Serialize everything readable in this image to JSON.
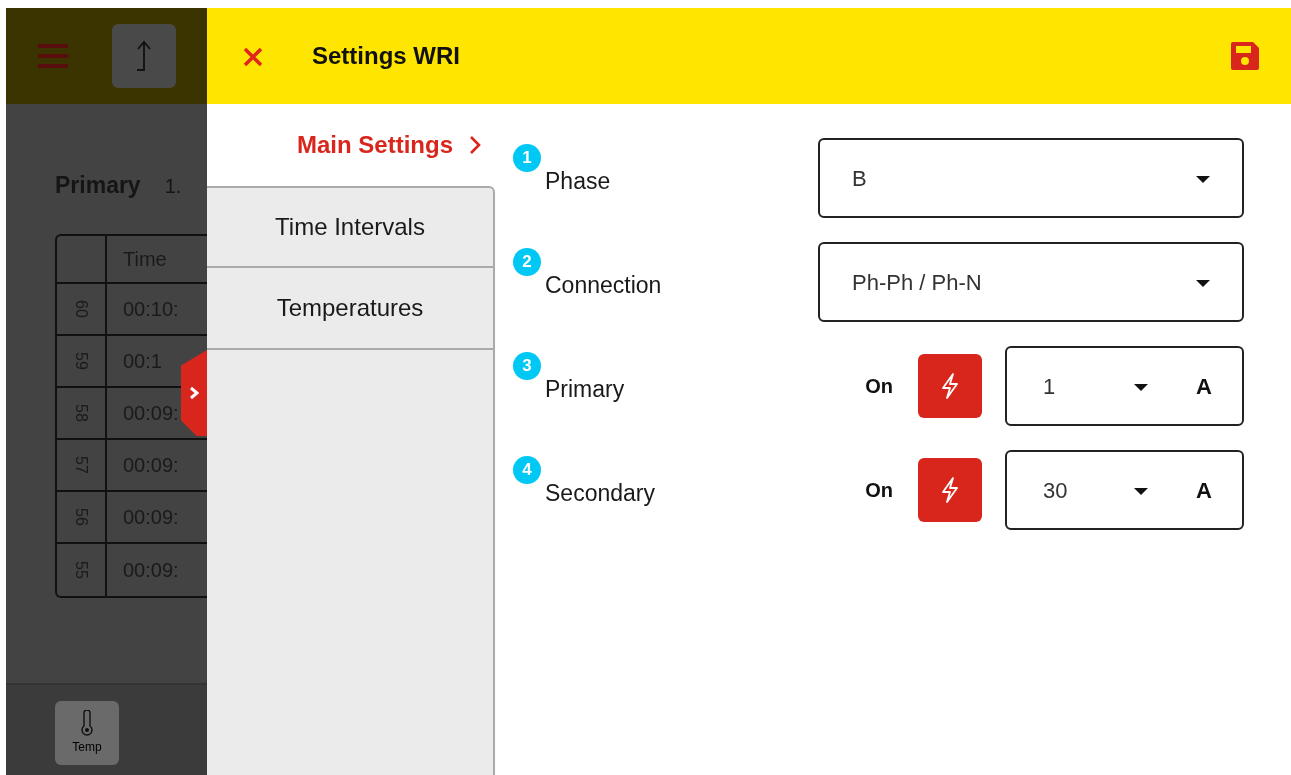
{
  "background_app": {
    "label": "Primary",
    "value": "1.",
    "table": {
      "columns": [
        "",
        "Time"
      ],
      "rows": [
        {
          "index": "60",
          "time": "00:10:"
        },
        {
          "index": "59",
          "time": "00:1"
        },
        {
          "index": "58",
          "time": "00:09:"
        },
        {
          "index": "57",
          "time": "00:09:"
        },
        {
          "index": "56",
          "time": "00:09:"
        },
        {
          "index": "55",
          "time": "00:09:"
        }
      ]
    },
    "bottom_bar": {
      "buttons": [
        {
          "label": "Temp"
        }
      ]
    }
  },
  "dialog": {
    "title": "Settings WRI",
    "menu": [
      {
        "label": "Main Settings",
        "selected": true
      },
      {
        "label": "Time Intervals",
        "selected": false
      },
      {
        "label": "Temperatures",
        "selected": false
      }
    ],
    "fields": [
      {
        "kind": "select",
        "number": "1",
        "label": "Phase",
        "value": "B"
      },
      {
        "kind": "select",
        "number": "2",
        "label": "Connection",
        "value": "Ph-Ph / Ph-N"
      },
      {
        "kind": "current",
        "number": "3",
        "label": "Primary",
        "status": "On",
        "value": "1",
        "unit": "A"
      },
      {
        "kind": "current",
        "number": "4",
        "label": "Secondary",
        "status": "On",
        "value": "30",
        "unit": "A"
      }
    ]
  }
}
